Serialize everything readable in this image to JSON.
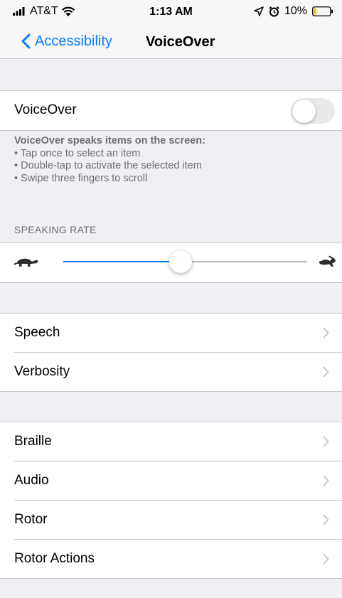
{
  "status_bar": {
    "carrier": "AT&T",
    "time": "1:13 AM",
    "battery": "10%",
    "icons": [
      "signal-bars-icon",
      "wifi-icon",
      "location-arrow-icon",
      "alarm-clock-icon",
      "battery-icon"
    ]
  },
  "navbar": {
    "back_label": "Accessibility",
    "title": "VoiceOver"
  },
  "voiceover": {
    "label": "VoiceOver",
    "enabled": false
  },
  "footnote": {
    "heading": "VoiceOver speaks items on the screen:",
    "bullets": [
      "• Tap once to select an item",
      "• Double-tap to activate the selected item",
      "• Swipe three fingers to scroll"
    ]
  },
  "speaking_rate": {
    "header": "SPEAKING RATE",
    "value": 0.48,
    "min_icon": "turtle-icon",
    "max_icon": "hare-icon"
  },
  "group1": [
    {
      "label": "Speech"
    },
    {
      "label": "Verbosity"
    }
  ],
  "group2": [
    {
      "label": "Braille"
    },
    {
      "label": "Audio"
    },
    {
      "label": "Rotor"
    },
    {
      "label": "Rotor Actions"
    }
  ],
  "colors": {
    "accent": "#0a7aff",
    "background": "#efeff4",
    "separator": "#c8c7cc",
    "chevron": "#c7c7cc",
    "secondary_text": "#6d6d72"
  }
}
